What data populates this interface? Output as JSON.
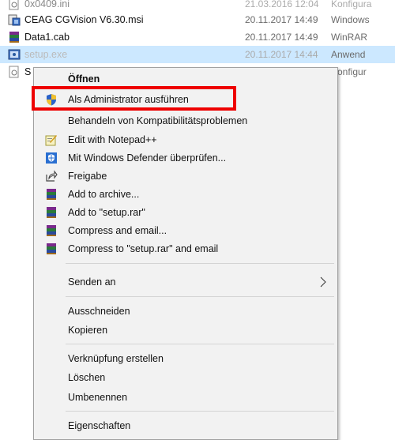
{
  "files": [
    {
      "name": "0x0409.ini",
      "date": "21.03.2016 12:04",
      "type": "Konfigura",
      "icon": "ini-file-icon"
    },
    {
      "name": "CEAG CGVision V6.30.msi",
      "date": "20.11.2017 14:49",
      "type": "Windows",
      "icon": "msi-installer-icon"
    },
    {
      "name": "Data1.cab",
      "date": "20.11.2017 14:49",
      "type": "WinRAR",
      "icon": "winrar-archive-icon"
    },
    {
      "name": "setup.exe",
      "date": "20.11.2017 14:44",
      "type": "Anwend",
      "icon": "setup-exe-icon"
    },
    {
      "name": "S",
      "date": "",
      "type": "Konfigur",
      "icon": "ini-file-icon"
    }
  ],
  "menu": {
    "open": "Öffnen",
    "run_as_admin": "Als Administrator ausführen",
    "compat": "Behandeln von Kompatibilitätsproblemen",
    "notepad": "Edit with Notepad++",
    "defender": "Mit Windows Defender überprüfen...",
    "share": "Freigabe",
    "add_archive": "Add to archive...",
    "add_setup_rar": "Add to \"setup.rar\"",
    "compress_email": "Compress and email...",
    "compress_setup_email": "Compress to \"setup.rar\" and email",
    "send_to": "Senden an",
    "cut": "Ausschneiden",
    "copy": "Kopieren",
    "create_shortcut": "Verknüpfung erstellen",
    "delete": "Löschen",
    "rename": "Umbenennen",
    "properties": "Eigenschaften"
  },
  "colors": {
    "highlight_border": "#ee0000",
    "selected_row": "#cce8ff",
    "menu_bg": "#f2f2f2"
  }
}
